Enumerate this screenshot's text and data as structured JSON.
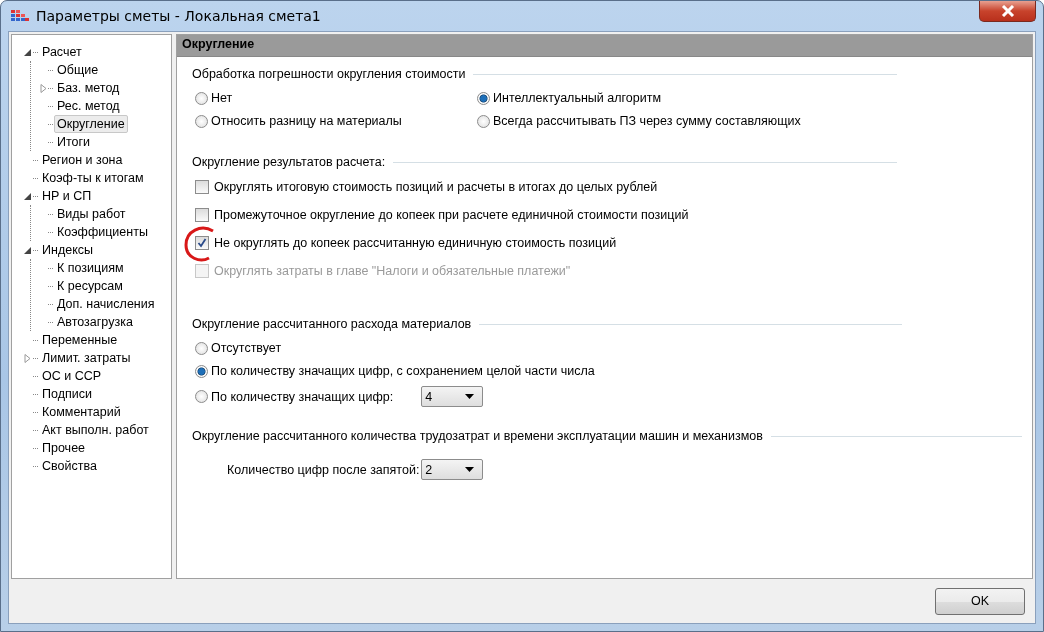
{
  "window": {
    "title": "Параметры сметы - Локальная смета1"
  },
  "tree": [
    {
      "label": "Расчет",
      "kind": "branch",
      "expanded": true,
      "selected": false,
      "children": [
        {
          "label": "Общие",
          "kind": "leaf",
          "selected": false
        },
        {
          "label": "Баз. метод",
          "kind": "branch",
          "expanded": false,
          "selected": false
        },
        {
          "label": "Рес. метод",
          "kind": "leaf",
          "selected": false
        },
        {
          "label": "Округление",
          "kind": "leaf",
          "selected": true
        },
        {
          "label": "Итоги",
          "kind": "leaf",
          "selected": false
        }
      ]
    },
    {
      "label": "Регион и зона",
      "kind": "leaf",
      "selected": false
    },
    {
      "label": "Коэф-ты к итогам",
      "kind": "leaf",
      "selected": false
    },
    {
      "label": "НР и СП",
      "kind": "branch",
      "expanded": true,
      "selected": false,
      "children": [
        {
          "label": "Виды работ",
          "kind": "leaf",
          "selected": false
        },
        {
          "label": "Коэффициенты",
          "kind": "leaf",
          "selected": false
        }
      ]
    },
    {
      "label": "Индексы",
      "kind": "branch",
      "expanded": true,
      "selected": false,
      "children": [
        {
          "label": "К позициям",
          "kind": "leaf",
          "selected": false
        },
        {
          "label": "К ресурсам",
          "kind": "leaf",
          "selected": false
        },
        {
          "label": "Доп. начисления",
          "kind": "leaf",
          "selected": false
        },
        {
          "label": "Автозагрузка",
          "kind": "leaf",
          "selected": false
        }
      ]
    },
    {
      "label": "Переменные",
      "kind": "leaf",
      "selected": false
    },
    {
      "label": "Лимит. затраты",
      "kind": "branch",
      "expanded": false,
      "selected": false
    },
    {
      "label": "ОС и ССР",
      "kind": "leaf",
      "selected": false
    },
    {
      "label": "Подписи",
      "kind": "leaf",
      "selected": false
    },
    {
      "label": "Комментарий",
      "kind": "leaf",
      "selected": false
    },
    {
      "label": "Акт выполн. работ",
      "kind": "leaf",
      "selected": false
    },
    {
      "label": "Прочее",
      "kind": "leaf",
      "selected": false
    },
    {
      "label": "Свойства",
      "kind": "leaf",
      "selected": false
    }
  ],
  "panel": {
    "title": "Округление",
    "error_handling": {
      "title": "Обработка погрешности округления стоимости",
      "options": [
        {
          "label": "Нет",
          "selected": false
        },
        {
          "label": "Интеллектуальный алгоритм",
          "selected": true
        },
        {
          "label": "Относить разницу на материалы",
          "selected": false
        },
        {
          "label": "Всегда рассчитывать ПЗ через сумму составляющих",
          "selected": false
        }
      ]
    },
    "results": {
      "title": "Округление результатов расчета:",
      "options": [
        {
          "label": "Округлять итоговую стоимость позиций и расчеты в итогах до целых рублей",
          "checked": false,
          "disabled": false,
          "highlighted": false
        },
        {
          "label": "Промежуточное округление до копеек при расчете единичной стоимости позиций",
          "checked": false,
          "disabled": false,
          "highlighted": false
        },
        {
          "label": "Не округлять до копеек рассчитанную единичную стоимость позиций",
          "checked": true,
          "disabled": false,
          "highlighted": true
        },
        {
          "label": "Округлять затраты в главе \"Налоги и обязательные платежи\"",
          "checked": false,
          "disabled": true,
          "highlighted": false
        }
      ]
    },
    "materials": {
      "title": "Округление рассчитанного расхода материалов",
      "options": [
        {
          "label": "Отсутствует",
          "selected": false
        },
        {
          "label": "По количеству значащих цифр, с сохранением целой части числа",
          "selected": true
        },
        {
          "label": "По количеству значащих цифр:",
          "selected": false,
          "dropdown": "4"
        }
      ]
    },
    "labor": {
      "title": "Округление рассчитанного количества трудозатрат и времени эксплуатации машин и механизмов",
      "label": "Количество цифр после запятой:",
      "dropdown": "2"
    }
  },
  "buttons": [
    "OK"
  ]
}
